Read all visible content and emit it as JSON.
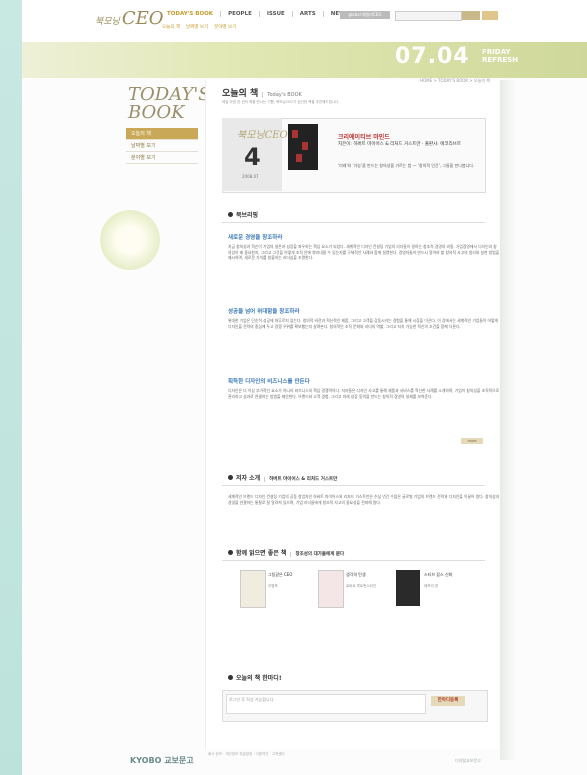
{
  "header": {
    "logo_small": "북모닝",
    "logo": "CEO",
    "nav": [
      "TODAY'S BOOK",
      "PEOPLE",
      "ISSUE",
      "ARTS",
      "NEWS"
    ],
    "sub_nav": [
      "오늘의 책",
      "날짜별 보기",
      "분야별 보기"
    ],
    "member_label": "global 패밀리CEO"
  },
  "banner": {
    "date": "07.04",
    "day": "FRIDAY",
    "action": "REFRESH"
  },
  "sidebar": {
    "title1": "TODAY'S",
    "title2": "BOOK",
    "items": [
      "오늘의 책",
      "날짜별 보기",
      "분야별 보기"
    ]
  },
  "breadcrumb": "HOME > TODAY'S BOOK > 오늘의 책",
  "page": {
    "title": "오늘의 책",
    "subtitle": "Today's BOOK",
    "description": "매일 아침 한 권의 책을 만나는 기쁨, 북모닝CEO가 엄선한 책을 추천해드립니다."
  },
  "book": {
    "brand": "북모닝CEO",
    "day": "4",
    "date": "2008.07",
    "title": "크리에이티브 마인드",
    "author": "지은이: 하버트 마이어스 & 리처드 거스트만 · 출판사: 에코리브르",
    "quote": "'미래'와 '가능'을 만드는 창의성을 기르는 법 — '창의적 인간', 그들을 만나봅니다."
  },
  "review": {
    "heading": "북브리핑",
    "sections": [
      {
        "title": "새로운 경영을 창조하라",
        "text": "지금 창의성과 혁신이 기업의 생존과 성장을 좌우하는 핵심 요소가 되었다. 세계적인 디자인 컨설팅 기업의 리더들이 말하는 창조적 경영의 비밀. 기업경영에서 디자인과 창의성이 왜 중요한지, 그리고 그것을 어떻게 조직 안에 뿌리내릴 수 있는지를 구체적인 사례와 함께 설명한다. 경영자들이 반드시 알아야 할 창의적 사고의 원리와 실천 방법을 제시하며, 새로운 가치를 창출하는 리더십을 조명한다."
      },
      {
        "title": "성공을 넘어 위대함을 창조하라",
        "text": "위대한 기업은 단순히 성공에 머무르지 않는다. 창의적 비전과 혁신적인 제품, 그리고 고객을 감동시키는 경험을 통해 시장을 이끈다. 이 장에서는 세계적인 기업들이 어떻게 디자인을 전략의 중심에 두고 경쟁 우위를 확보했는지 살펴본다. 창의적인 조직 문화와 리더의 역할, 그리고 지속 가능한 혁신의 조건을 함께 다룬다."
      },
      {
        "title": "획득한 디자인의 비즈니스를 만든다",
        "text": "디자인은 더 이상 부가적인 요소가 아니라 비즈니스의 핵심 경쟁력이다. 저자들은 디자인 사고를 통해 제품과 서비스를 혁신한 사례를 소개하며, 기업이 창의성을 조직적으로 관리하고 성과로 연결하는 방법을 제안한다. 브랜드와 고객 경험, 그리고 미래 성장 동력을 만드는 창의적 경영의 실제를 보여준다."
      }
    ],
    "more": "more"
  },
  "author_section": {
    "heading": "저자 소개",
    "sub": "하버트 마이어스 & 리처드 거스트만",
    "text": "세계적인 브랜드 디자인 컨설팅 기업의 공동 창업자인 하버트 마이어스와 리처드 거스트만은 수십 년간 수많은 글로벌 기업의 브랜드 전략과 디자인을 이끌어 왔다. 창의성과 경영을 연결하는 통찰로 잘 알려져 있으며, 기업 리더들에게 창조적 사고의 중요성을 전파해 왔다."
  },
  "related": {
    "heading": "함께 읽으면 좋은 책",
    "sub": "창조성의 대가들에게 묻다",
    "books": [
      {
        "title": "그림같은 CEO",
        "author": "이명옥"
      },
      {
        "title": "생각의 탄생",
        "author": "로버트 루트번스타인"
      },
      {
        "title": "스티브 잡스 신화",
        "author": "제프리 영"
      }
    ]
  },
  "comment": {
    "heading": "오늘의 책 한마디!",
    "placeholder": "로그인 후 작성 가능합니다.",
    "button": "한마디등록"
  },
  "footer": {
    "logo": "KYOBO 교보문고",
    "info": "회사 정보 · 개인정보 취급방침 · 이용약관 · 고객센터",
    "right": "디지털교보문고"
  }
}
